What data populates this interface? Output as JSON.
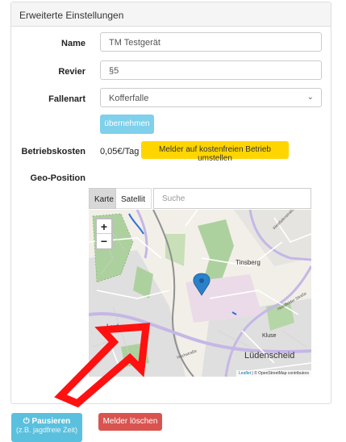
{
  "panel": {
    "title": "Erweiterte Einstellungen"
  },
  "form": {
    "name_label": "Name",
    "name_value": "TM Testgerät",
    "revier_label": "Revier",
    "revier_value": "§5",
    "fallenart_label": "Fallenart",
    "fallenart_value": "Kofferfalle",
    "apply_label": "übernehmen",
    "betriebskosten_label": "Betriebskosten",
    "betriebskosten_value": "0,05€/Tag",
    "free_mode_label": "Melder auf kostenfreien Betrieb umstellen",
    "geo_label": "Geo-Position"
  },
  "map": {
    "tab_map": "Karte",
    "tab_satellite": "Satellit",
    "search_placeholder": "Suche",
    "zoom_in": "+",
    "zoom_out": "−",
    "places": [
      "Tinsberg",
      "Ludenscheid",
      "Kluse",
      "Lüdenscheid",
      "Westfalenstraße",
      "Heedfelder Straße",
      "Hochstraße"
    ],
    "attribution_leaflet": "Leaflet",
    "attribution_text": "| © OpenStreetMap contributors",
    "colors": {
      "forest": "#add19e",
      "residential": "#e0dfdf",
      "road": "#ffffff",
      "primary": "#c5b7e6",
      "rail": "#909090",
      "water": "#2f6fd8"
    }
  },
  "actions": {
    "pause_label": "Pausieren",
    "pause_sub": "(z.B. jagdfreie Zeit)",
    "delete_label": "Melder löschen"
  },
  "icons": {
    "pause": "power-icon",
    "marker": "map-marker-icon",
    "select": "chevron-down-icon"
  }
}
